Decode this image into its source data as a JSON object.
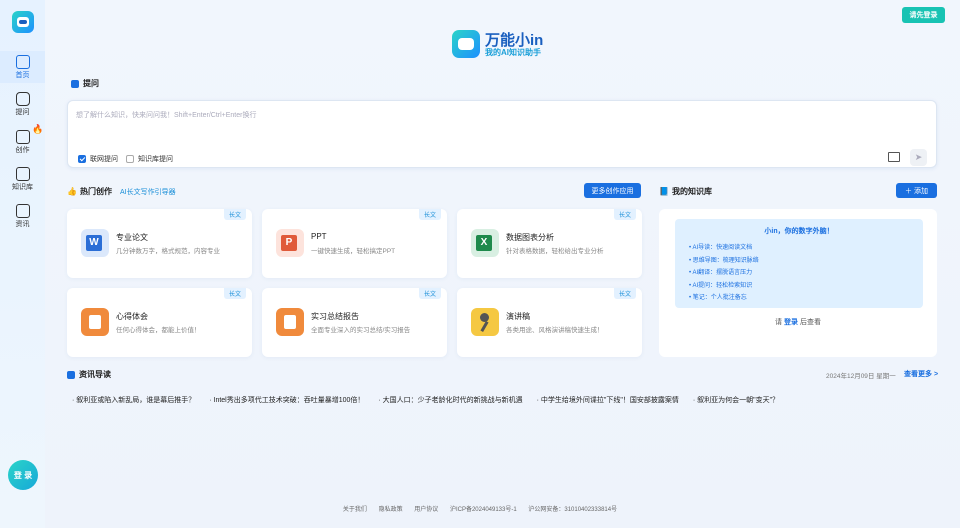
{
  "sidebar": {
    "items": [
      {
        "label": "首页"
      },
      {
        "label": "提问"
      },
      {
        "label": "创作"
      },
      {
        "label": "知识库"
      },
      {
        "label": "资讯"
      }
    ],
    "login": "登 录"
  },
  "header": {
    "login_button": "请先登录",
    "brand_title": "万能小in",
    "brand_subtitle": "我的AI知识助手"
  },
  "ask": {
    "title": "提问",
    "placeholder": "想了解什么知识，快来问问我！Shift+Enter/Ctrl+Enter换行",
    "opt_web": "联网提问",
    "opt_kb": "知识库提问",
    "opt_web_checked": true,
    "opt_kb_checked": false
  },
  "hot": {
    "title": "热门创作",
    "sub_link": "AI长文写作引导器",
    "more_button": "更多创作应用",
    "cards": [
      {
        "title": "专业论文",
        "desc": "几分钟数万字，格式规范，内容专业",
        "tag": "长文",
        "icon": "word-icon",
        "color": "#2b6ed6"
      },
      {
        "title": "PPT",
        "desc": "一键快速生成，轻松搞定PPT",
        "tag": "长文",
        "icon": "ppt-icon",
        "color": "#e05a3a"
      },
      {
        "title": "数据图表分析",
        "desc": "针对表格数据，轻松给出专业分析",
        "tag": "长文",
        "icon": "excel-icon",
        "color": "#1e8a4c"
      },
      {
        "title": "心得体会",
        "desc": "任何心得体会，都能上价值！",
        "tag": "长文",
        "icon": "notes-icon",
        "color": "#f08a3c"
      },
      {
        "title": "实习总结报告",
        "desc": "全面专业深入的实习总结/实习报告",
        "tag": "长文",
        "icon": "report-icon",
        "color": "#f08a3c"
      },
      {
        "title": "演讲稿",
        "desc": "各类用途、风格演讲稿快速生成！",
        "tag": "长文",
        "icon": "mic-icon",
        "color": "#f5c842"
      }
    ]
  },
  "kb": {
    "title": "我的知识库",
    "add_button": "＋ 添加",
    "headline": "小in，你的数字外脑！",
    "features": [
      "AI导读：快速阅读文档",
      "思维导图：梳理知识脉络",
      "AI翻译：摆脱语言压力",
      "AI提问：轻松检索知识",
      "笔记：个人批注备忘"
    ],
    "login_prefix": "请",
    "login_link": "登录",
    "login_suffix": "后查看"
  },
  "news": {
    "title": "资讯导读",
    "date": "2024年12月09日 星期一",
    "more": "查看更多 >",
    "items": [
      "· 叙利亚或陷入新乱局，谁是幕后推手？",
      "· Intel秀出多项代工技术突破：吞吐量暴增100倍！",
      "· 大国人口：少子老龄化时代的新挑战与新机遇",
      "· 中学生给境外间谍拉\"下线\"！国安部披露案情",
      "· 叙利亚为何会一朝\"变天\"？"
    ]
  },
  "footer": [
    "关于我们",
    "隐私政策",
    "用户协议",
    "沪ICP备2024049133号-1",
    "沪公网安备：31010402333814号"
  ]
}
